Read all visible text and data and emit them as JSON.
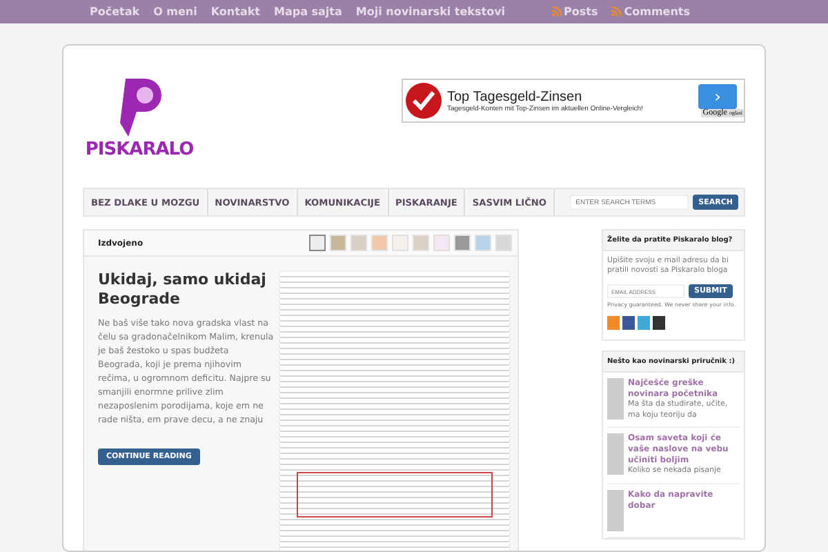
{
  "top_menu": {
    "links": [
      "Početak",
      "O meni",
      "Kontakt",
      "Mapa sajta",
      "Moji novinarski tekstovi"
    ],
    "feeds": [
      "Posts",
      "Comments"
    ]
  },
  "logo": {
    "text": "PISKARALO"
  },
  "ad": {
    "title": "Top Tagesgeld-Zinsen",
    "text": "Tagesgeld-Konten mit Top-Zinsen im aktuellen Online-Vergleich!",
    "brand": "Google",
    "brand_suffix": "oglasi",
    "arrow": "›"
  },
  "nav": {
    "items": [
      "BEZ DLAKE U MOZGU",
      "NOVINARSTVO",
      "KOMUNIKACIJE",
      "PISKARANJE",
      "SASVIM LIČNO"
    ],
    "search_placeholder": "ENTER SEARCH TERMS",
    "search_button": "SEARCH"
  },
  "featured": {
    "heading": "Izdvojeno",
    "thumbnail_count_selected": [
      true,
      false,
      false,
      false,
      false,
      false,
      false,
      false,
      false,
      false
    ],
    "post": {
      "title": "Ukidaj, samo ukidaj Beograde",
      "excerpt": "Ne baš više tako nova gradska vlast na čelu sa gradonačelnikom Malim, krenula je baš žestoko u spas budžeta Beograda, koji je prema njihovim rečima, u ogromnom deficitu.  Najpre su smanjili enormne prilive zlim nezaposlenim porodijama, koje em ne rade ništa, em prave decu, a ne znaju",
      "button": "CONTINUE READING"
    }
  },
  "subscribe": {
    "heading": "Želite da pratite Piskaralo blog?",
    "text": "Upišite svoju e mail adresu da bi pratili novosti sa Piskaralo bloga",
    "placeholder": "EMAIL ADDRESS",
    "button": "SUBMIT",
    "privacy": "Privacy guaranteed. We never share your info."
  },
  "handbook": {
    "heading": "Nešto kao novinarski priručnik :)",
    "posts": [
      {
        "title": "Najčešće greške novinara početnika",
        "excerpt": "  Ma šta da studirate, učite, ma koju teoriju da"
      },
      {
        "title": "Osam saveta koji će vaše naslove na vebu učiniti boljim",
        "excerpt": "Koliko se nekada pisanje"
      },
      {
        "title": "Kako da napravite dobar"
      }
    ]
  }
}
